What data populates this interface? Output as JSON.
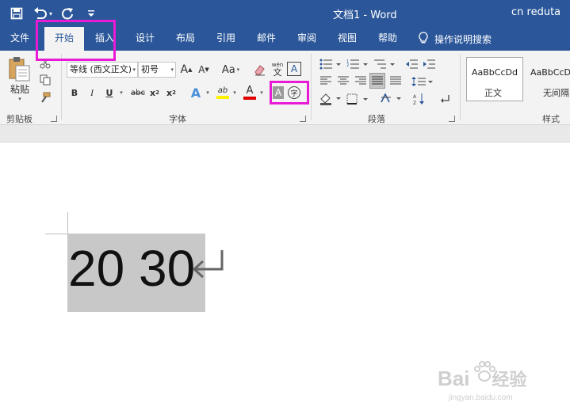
{
  "window": {
    "title": "文档1  -  Word",
    "user": "cn reduta"
  },
  "quick_access": {
    "icons": [
      "save-icon",
      "undo-icon",
      "redo-icon",
      "customize-icon"
    ]
  },
  "tabs": [
    {
      "label": "文件",
      "active": false
    },
    {
      "label": "开始",
      "active": true
    },
    {
      "label": "插入",
      "active": false
    },
    {
      "label": "设计",
      "active": false
    },
    {
      "label": "布局",
      "active": false
    },
    {
      "label": "引用",
      "active": false
    },
    {
      "label": "邮件",
      "active": false
    },
    {
      "label": "审阅",
      "active": false
    },
    {
      "label": "视图",
      "active": false
    },
    {
      "label": "帮助",
      "active": false
    }
  ],
  "tell_me": {
    "label": "操作说明搜索",
    "icon": "lightbulb-icon"
  },
  "ribbon": {
    "clipboard": {
      "group_label": "剪贴板",
      "paste_label": "粘贴"
    },
    "font": {
      "group_label": "字体",
      "font_name": "等线 (西文正文)",
      "font_size": "初号",
      "grow_label": "A",
      "shrink_label": "A",
      "case_label": "Aa",
      "pinyin_top": "wén",
      "pinyin_bottom": "文",
      "border_char": "A",
      "bold": "B",
      "italic": "I",
      "underline": "U",
      "strike": "abc",
      "sub": "x",
      "sub_mark": "2",
      "sup": "x",
      "sup_mark": "2",
      "effects": "A",
      "highlight": "ab",
      "color": "A",
      "shading": "A",
      "enclose": "字"
    },
    "paragraph": {
      "group_label": "段落"
    },
    "styles": {
      "group_label": "样式",
      "items": [
        {
          "sample": "AaBbCcDd",
          "name": "正文"
        },
        {
          "sample": "AaBbCcDd",
          "name": "无间隔"
        }
      ]
    }
  },
  "document": {
    "text": "20 30"
  },
  "colors": {
    "titlebar": "#2b579a",
    "highlight_box": "#e81ad6",
    "selection": "#c8c8c8"
  },
  "watermark": {
    "brand": "Bai",
    "brand2": "经验",
    "url": "jingyan.baidu.com"
  }
}
